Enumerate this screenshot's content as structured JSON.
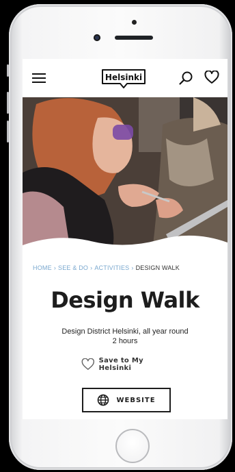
{
  "header": {
    "logo_text": "Helsinki"
  },
  "breadcrumb": {
    "items": [
      "HOME",
      "SEE & DO",
      "ACTIVITIES"
    ],
    "current": "DESIGN WALK",
    "separator": "›"
  },
  "page": {
    "title": "Design Walk",
    "location_line": "Design District Helsinki, all year round",
    "duration_line": "2 hours",
    "save_label": "Save to My Helsinki",
    "website_label": "WEBSITE"
  },
  "icons": [
    "menu-icon",
    "search-icon",
    "heart-icon",
    "globe-icon"
  ],
  "colors": {
    "breadcrumb_link": "#7aa8cf",
    "title_text": "#1d1d1d",
    "screen_bg": "#ffffff",
    "outer_bg": "#000000"
  }
}
